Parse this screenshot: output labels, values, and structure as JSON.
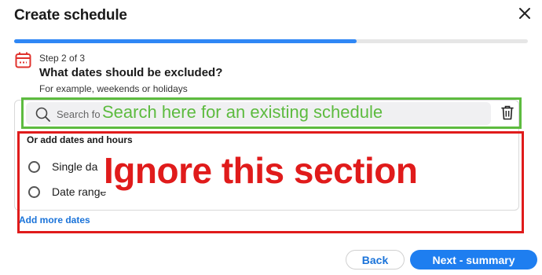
{
  "dialog": {
    "title": "Create schedule",
    "close_icon": "close-icon"
  },
  "progress": {
    "fraction": 0.667
  },
  "step": {
    "icon": "calendar-icon",
    "label": "Step 2 of 3",
    "question": "What dates should be excluded?",
    "hint": "For example, weekends or holidays"
  },
  "search": {
    "icon": "search-icon",
    "placeholder": "Search fo",
    "delete_icon": "trash-icon"
  },
  "add_dates": {
    "heading": "Or add dates and hours",
    "options": [
      {
        "label": "Single da"
      },
      {
        "label": "Date range"
      }
    ],
    "add_more_label": "Add more dates"
  },
  "annotations": {
    "search_note": "Search here for an existing schedule",
    "ignore_note": "Ignore this section",
    "green": "#5dbb3f",
    "red": "#e01b1b"
  },
  "footer": {
    "back_label": "Back",
    "next_label": "Next - summary"
  },
  "colors": {
    "accent": "#1e7ef0",
    "progress": "#2f87f5"
  }
}
